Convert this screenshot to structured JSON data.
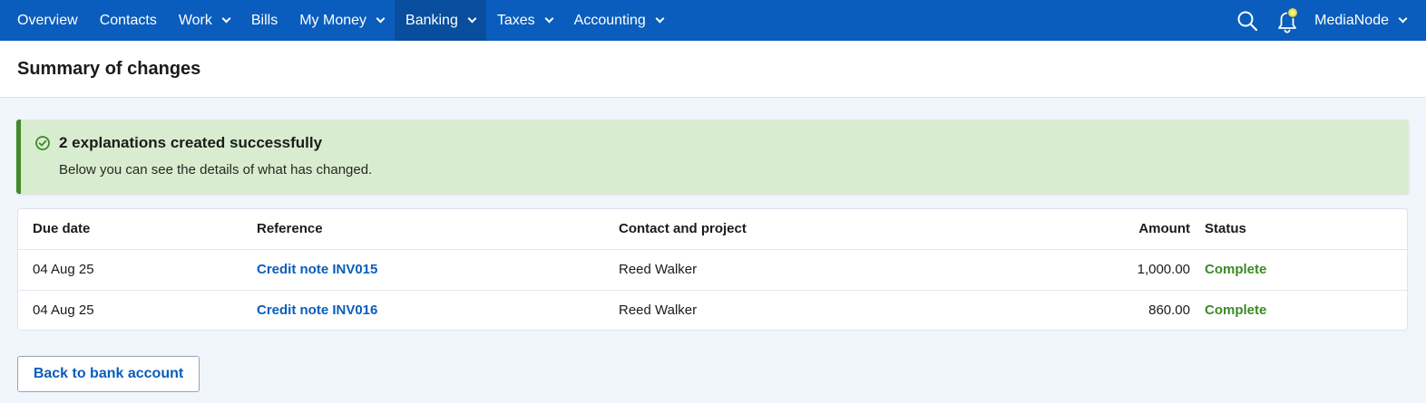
{
  "nav": {
    "items": [
      {
        "label": "Overview",
        "dropdown": false,
        "active": false
      },
      {
        "label": "Contacts",
        "dropdown": false,
        "active": false
      },
      {
        "label": "Work",
        "dropdown": true,
        "active": false
      },
      {
        "label": "Bills",
        "dropdown": false,
        "active": false
      },
      {
        "label": "My Money",
        "dropdown": true,
        "active": false
      },
      {
        "label": "Banking",
        "dropdown": true,
        "active": true
      },
      {
        "label": "Taxes",
        "dropdown": true,
        "active": false
      },
      {
        "label": "Accounting",
        "dropdown": true,
        "active": false
      }
    ],
    "organization": "MediaNode",
    "icons": {
      "search": "search-icon",
      "notifications": "bell-icon"
    },
    "colors": {
      "bar": "#0a5dbd",
      "active": "#094e9e",
      "notification_dot": "#e8e03a"
    }
  },
  "page": {
    "title": "Summary of changes"
  },
  "banner": {
    "title": "2 explanations created successfully",
    "message": "Below you can see the details of what has changed.",
    "icon": "check-circle-icon",
    "colors": {
      "background": "#d8edcf",
      "accent": "#3f8a26"
    }
  },
  "table": {
    "headers": {
      "due_date": "Due date",
      "reference": "Reference",
      "contact": "Contact and project",
      "amount": "Amount",
      "status": "Status"
    },
    "rows": [
      {
        "due_date": "04 Aug 25",
        "reference": "Credit note INV015",
        "contact": "Reed Walker",
        "amount": "1,000.00",
        "status": "Complete"
      },
      {
        "due_date": "04 Aug 25",
        "reference": "Credit note INV016",
        "contact": "Reed Walker",
        "amount": "860.00",
        "status": "Complete"
      }
    ],
    "colors": {
      "link": "#0a5dbd",
      "status_complete": "#3b8a25"
    }
  },
  "actions": {
    "back_label": "Back to bank account"
  }
}
